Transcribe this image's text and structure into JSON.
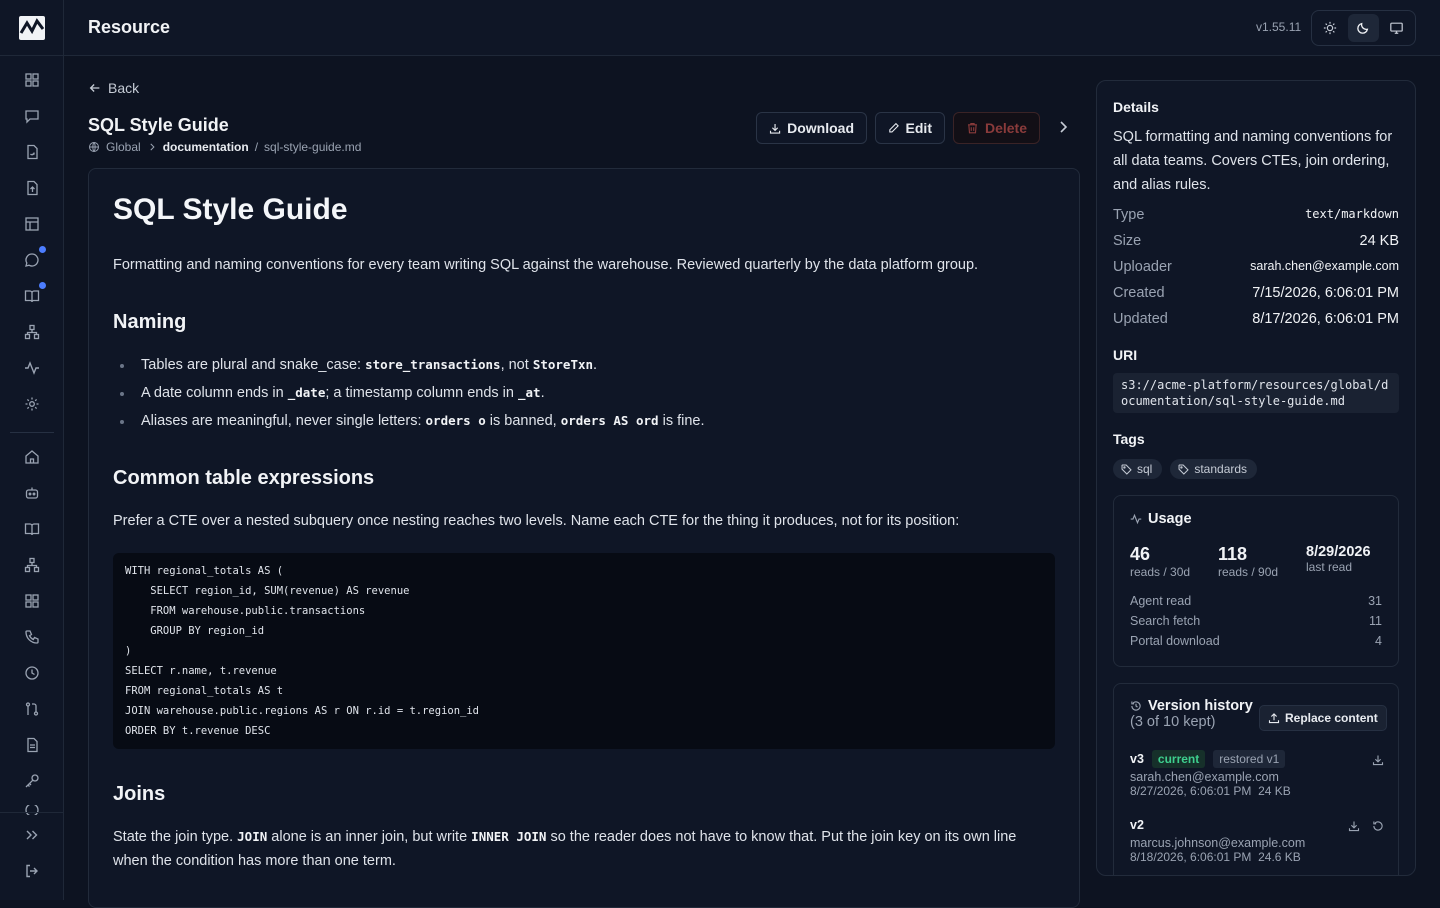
{
  "header": {
    "app_title": "Resource",
    "version": "v1.55.11"
  },
  "nav": {
    "back": "Back"
  },
  "resource": {
    "title": "SQL Style Guide",
    "breadcrumb": {
      "scope": "Global",
      "folder": "documentation",
      "separator": "/",
      "file": "sql-style-guide.md"
    }
  },
  "actions": {
    "download": "Download",
    "edit": "Edit",
    "delete": "Delete"
  },
  "document": {
    "h1": "SQL Style Guide",
    "intro": "Formatting and naming conventions for every team writing SQL against the warehouse. Reviewed quarterly by the data platform group.",
    "naming_heading": "Naming",
    "naming_items": [
      {
        "t1": "Tables are plural and snake_case: ",
        "c1": "store_transactions",
        "t2": ", not ",
        "c2": "StoreTxn",
        "t3": "."
      },
      {
        "t1": "A date column ends in ",
        "c1": "_date",
        "t2": "; a timestamp column ends in ",
        "c2": "_at",
        "t3": "."
      },
      {
        "t1": "Aliases are meaningful, never single letters: ",
        "c1": "orders o",
        "t2": " is banned, ",
        "c2": "orders AS ord",
        "t3": " is fine."
      }
    ],
    "cte_heading": "Common table expressions",
    "cte_text": "Prefer a CTE over a nested subquery once nesting reaches two levels. Name each CTE for the thing it produces, not for its position:",
    "code_lines": [
      "WITH regional_totals AS (",
      "    SELECT region_id, SUM(revenue) AS revenue",
      "    FROM warehouse.public.transactions",
      "    GROUP BY region_id",
      ")",
      "SELECT r.name, t.revenue",
      "FROM regional_totals AS t",
      "JOIN warehouse.public.regions AS r ON r.id = t.region_id",
      "ORDER BY t.revenue DESC"
    ],
    "joins_heading": "Joins",
    "joins": {
      "t1": "State the join type. ",
      "c1": "JOIN",
      "t2": " alone is an inner join, but write ",
      "c2": "INNER JOIN",
      "t3": " so the reader does not have to know that. Put the join key on its own line when the condition has more than one term."
    }
  },
  "details": {
    "heading": "Details",
    "description": "SQL formatting and naming conventions for all data teams. Covers CTEs, join ordering, and alias rules.",
    "fields": [
      {
        "key": "Type",
        "value": "text/markdown"
      },
      {
        "key": "Size",
        "value": "24 KB"
      },
      {
        "key": "Uploader",
        "value": "sarah.chen@example.com"
      },
      {
        "key": "Created",
        "value": "7/15/2026, 6:06:01 PM"
      },
      {
        "key": "Updated",
        "value": "8/17/2026, 6:06:01 PM"
      }
    ],
    "uri_heading": "URI",
    "uri": "s3://acme-platform/resources/global/documentation/sql-style-guide.md",
    "tags_heading": "Tags",
    "tags": [
      "sql",
      "standards"
    ]
  },
  "usage": {
    "heading": "Usage",
    "stats": [
      {
        "value": "46",
        "label": "reads / 30d"
      },
      {
        "value": "118",
        "label": "reads / 90d"
      },
      {
        "value": "8/29/2026",
        "label": "last read"
      }
    ],
    "breakdown": [
      {
        "label": "Agent read",
        "value": "31"
      },
      {
        "label": "Search fetch",
        "value": "11"
      },
      {
        "label": "Portal download",
        "value": "4"
      }
    ]
  },
  "versions": {
    "heading": "Version history",
    "subheading": "(3 of 10 kept)",
    "replace": "Replace content",
    "items": [
      {
        "version": "v3",
        "badge_current": "current",
        "badge_note": "restored v1",
        "author": "sarah.chen@example.com",
        "date": "8/27/2026, 6:06:01 PM",
        "size": "24 KB"
      },
      {
        "version": "v2",
        "author": "marcus.johnson@example.com",
        "date": "8/18/2026, 6:06:01 PM",
        "size": "24.6 KB"
      }
    ]
  },
  "colors": {
    "background": "#0d1321",
    "accent_dot": "#4c7dff",
    "current_badge": "#3ecf8e",
    "danger": "#8a3b3b"
  }
}
